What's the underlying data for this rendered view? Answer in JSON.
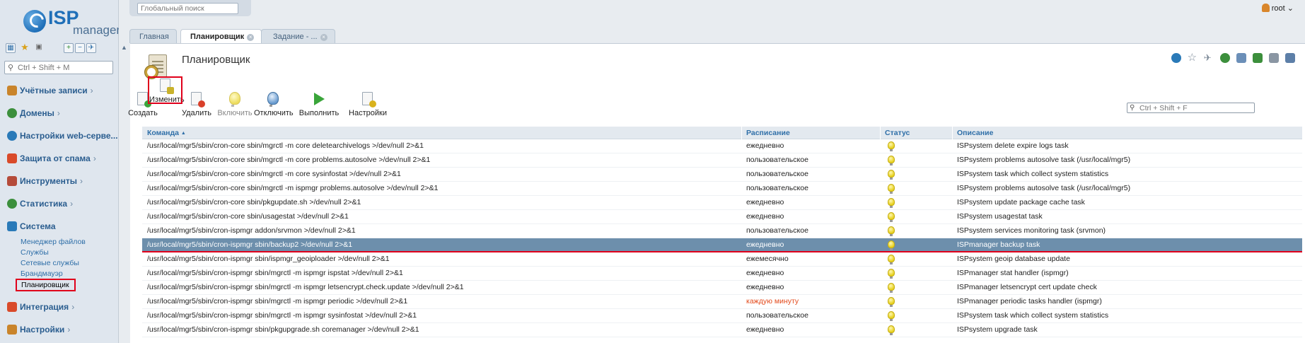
{
  "brand": {
    "isp": "ISP",
    "manager": "manager"
  },
  "search": {
    "global_placeholder": "Глобальный поиск",
    "menu_placeholder": "Ctrl + Shift + M",
    "table_placeholder": "Ctrl + Shift + F"
  },
  "user": {
    "name": "root",
    "caret": "⌄"
  },
  "menu": {
    "groups": [
      {
        "label": "Учётные записи",
        "icon": "users-icon",
        "color": "#c9842b"
      },
      {
        "label": "Домены",
        "icon": "globe-icon",
        "color": "#3c8f3c"
      },
      {
        "label": "Настройки web-серве...",
        "icon": "web-settings-icon",
        "color": "#2a7ab8"
      },
      {
        "label": "Защита от спама",
        "icon": "spam-shield-icon",
        "color": "#d94a2a"
      },
      {
        "label": "Инструменты",
        "icon": "tools-icon",
        "color": "#b54b3a"
      },
      {
        "label": "Статистика",
        "icon": "stats-icon",
        "color": "#3c8f3c"
      },
      {
        "label": "Система",
        "icon": "system-icon",
        "color": "#2a7ab8"
      },
      {
        "label": "Интеграция",
        "icon": "integration-icon",
        "color": "#d94a2a"
      },
      {
        "label": "Настройки",
        "icon": "settings-icon",
        "color": "#c9842b"
      }
    ],
    "system_items": [
      "Менеджер файлов",
      "Службы",
      "Сетевые службы",
      "Брандмауэр",
      "Планировщик"
    ]
  },
  "tabs": [
    {
      "label": "Главная"
    },
    {
      "label": "Планировщик"
    },
    {
      "label": "Задание - ..."
    }
  ],
  "page": {
    "title": "Планировщик"
  },
  "toolbar": {
    "create": "Создать",
    "edit": "Изменить",
    "delete": "Удалить",
    "enable": "Включить",
    "disable": "Отключить",
    "run": "Выполнить",
    "settings": "Настройки"
  },
  "table": {
    "headers": {
      "command": "Команда",
      "sort_marker": "▲",
      "schedule": "Расписание",
      "status": "Статус",
      "description": "Описание"
    },
    "rows": [
      {
        "command": "/usr/local/mgr5/sbin/cron-core sbin/mgrctl -m core deletearchivelogs >/dev/null 2>&1",
        "schedule": "ежедневно",
        "description": "ISPsystem delete expire logs task"
      },
      {
        "command": "/usr/local/mgr5/sbin/cron-core sbin/mgrctl -m core problems.autosolve >/dev/null 2>&1",
        "schedule": "пользовательское",
        "description": "ISPsystem problems autosolve task (/usr/local/mgr5)"
      },
      {
        "command": "/usr/local/mgr5/sbin/cron-core sbin/mgrctl -m core sysinfostat >/dev/null 2>&1",
        "schedule": "пользовательское",
        "description": "ISPsystem task which collect system statistics"
      },
      {
        "command": "/usr/local/mgr5/sbin/cron-core sbin/mgrctl -m ispmgr problems.autosolve >/dev/null 2>&1",
        "schedule": "пользовательское",
        "description": "ISPsystem problems autosolve task (/usr/local/mgr5)"
      },
      {
        "command": "/usr/local/mgr5/sbin/cron-core sbin/pkgupdate.sh >/dev/null 2>&1",
        "schedule": "ежедневно",
        "description": "ISPsystem update package cache task"
      },
      {
        "command": "/usr/local/mgr5/sbin/cron-core sbin/usagestat >/dev/null 2>&1",
        "schedule": "ежедневно",
        "description": "ISPsystem usagestat task"
      },
      {
        "command": "/usr/local/mgr5/sbin/cron-ispmgr addon/srvmon >/dev/null 2>&1",
        "schedule": "пользовательское",
        "description": "ISPsystem services monitoring task (srvmon)"
      },
      {
        "command": "/usr/local/mgr5/sbin/cron-ispmgr sbin/backup2 >/dev/null 2>&1",
        "schedule": "ежедневно",
        "description": "ISPmanager backup task"
      },
      {
        "command": "/usr/local/mgr5/sbin/cron-ispmgr sbin/ispmgr_geoiploader >/dev/null 2>&1",
        "schedule": "ежемесячно",
        "description": "ISPsystem geoip database update"
      },
      {
        "command": "/usr/local/mgr5/sbin/cron-ispmgr sbin/mgrctl -m ispmgr ispstat >/dev/null 2>&1",
        "schedule": "ежедневно",
        "description": "ISPmanager stat handler (ispmgr)"
      },
      {
        "command": "/usr/local/mgr5/sbin/cron-ispmgr sbin/mgrctl -m ispmgr letsencrypt.check.update >/dev/null 2>&1",
        "schedule": "ежедневно",
        "description": "ISPmanager letsencrypt cert update check"
      },
      {
        "command": "/usr/local/mgr5/sbin/cron-ispmgr sbin/mgrctl -m ispmgr periodic >/dev/null 2>&1",
        "schedule": "каждую минуту",
        "description": "ISPmanager periodic tasks handler (ispmgr)"
      },
      {
        "command": "/usr/local/mgr5/sbin/cron-ispmgr sbin/mgrctl -m ispmgr sysinfostat >/dev/null 2>&1",
        "schedule": "пользовательское",
        "description": "ISPsystem task which collect system statistics"
      },
      {
        "command": "/usr/local/mgr5/sbin/cron-ispmgr sbin/pkgupgrade.sh coremanager >/dev/null 2>&1",
        "schedule": "ежедневно",
        "description": "ISPsystem upgrade task"
      }
    ]
  }
}
